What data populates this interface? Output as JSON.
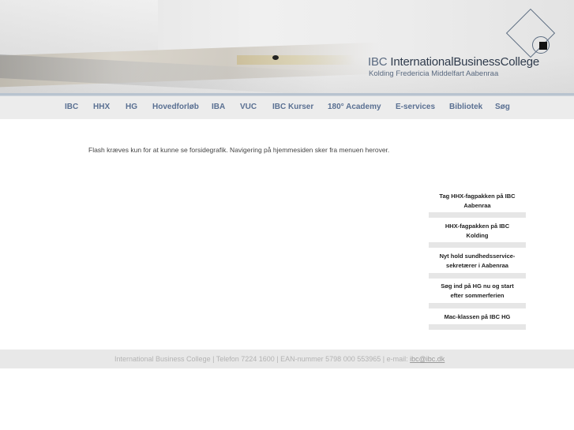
{
  "header": {
    "brand_prefix": "IBC",
    "brand_name": "InternationalBusinessCollege",
    "locations": "Kolding Fredericia Middelfart Aabenraa"
  },
  "nav": {
    "items": [
      "IBC",
      "HHX",
      "HG",
      "Hovedforløb",
      "IBA",
      "VUC",
      "IBC Kurser",
      "180° Academy",
      "E-services",
      "Bibliotek",
      "Søg"
    ]
  },
  "intro": {
    "text": "Flash kræves kun for at kunne se forsidegrafik. Navigering på hjemmesiden sker fra menuen herover."
  },
  "news": [
    {
      "line1": "Tag HHX-fagpakken på IBC",
      "line2": "Aabenraa"
    },
    {
      "line1": "HHX-fagpakken på IBC",
      "line2": "Kolding"
    },
    {
      "line1": "Nyt hold sundhedsservice-",
      "line2": "sekretærer i Aabenraa"
    },
    {
      "line1": "Søg ind på HG nu og start",
      "line2": "efter sommerferien"
    },
    {
      "line1": "Mac-klassen på IBC HG",
      "line2": ""
    }
  ],
  "footer": {
    "text": "International Business College | Telefon 7224 1600 | EAN-nummer 5798 000 553965 | e-mail: ",
    "email": "ibc@ibc.dk"
  },
  "colors": {
    "nav_text": "#5a7092",
    "nav_bg": "#ececec",
    "footer_bg": "#e8e8e8",
    "brand": "#2f3b4c"
  }
}
